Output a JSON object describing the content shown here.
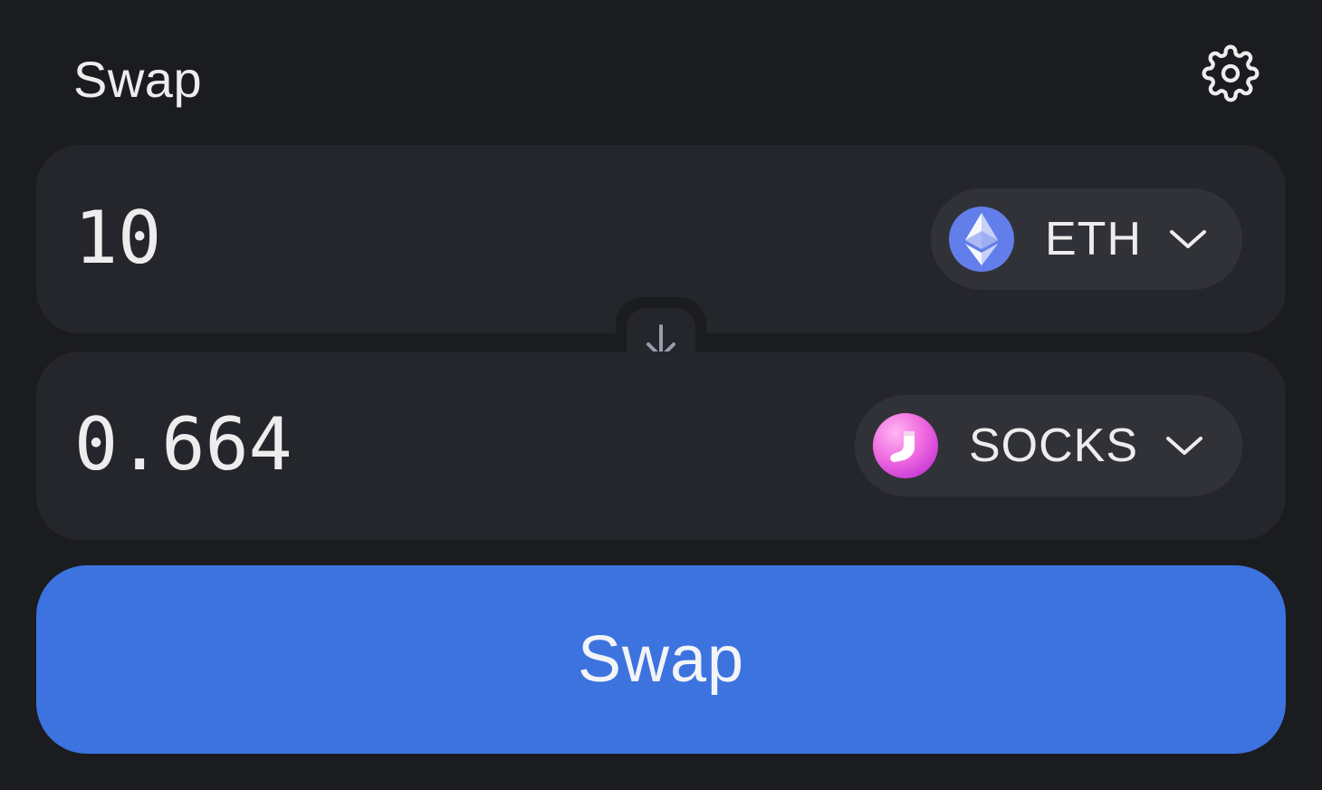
{
  "header": {
    "title": "Swap",
    "settings_icon": "gear-icon"
  },
  "input": {
    "amount": "10",
    "token": {
      "symbol": "ETH",
      "icon": "ethereum-logo-icon",
      "color": "#627eea"
    }
  },
  "flip": {
    "icon": "arrow-down-icon"
  },
  "output": {
    "amount": "0.664",
    "token": {
      "symbol": "SOCKS",
      "icon": "socks-logo-icon",
      "color": "#e05ad8"
    }
  },
  "action": {
    "label": "Swap",
    "color": "#3c73df"
  }
}
